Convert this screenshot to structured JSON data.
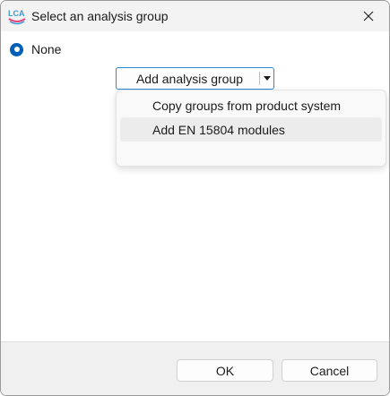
{
  "window": {
    "title": "Select an analysis group",
    "app_icon": "openlca-icon",
    "app_icon_text": "LCA",
    "close_icon": "close-icon"
  },
  "radio": {
    "label": "None",
    "checked": true
  },
  "split_button": {
    "label": "Add analysis group",
    "arrow_icon": "caret-down-icon"
  },
  "dropdown": {
    "items": [
      {
        "label": "Copy groups from product system",
        "highlighted": false
      },
      {
        "label": "Add EN 15804 modules",
        "highlighted": true
      }
    ]
  },
  "footer": {
    "ok_label": "OK",
    "cancel_label": "Cancel"
  },
  "colors": {
    "accent": "#005fb8",
    "focus_border": "#2a8ad4",
    "icon_pink": "#e0457b",
    "icon_blue": "#3d9ad8"
  }
}
